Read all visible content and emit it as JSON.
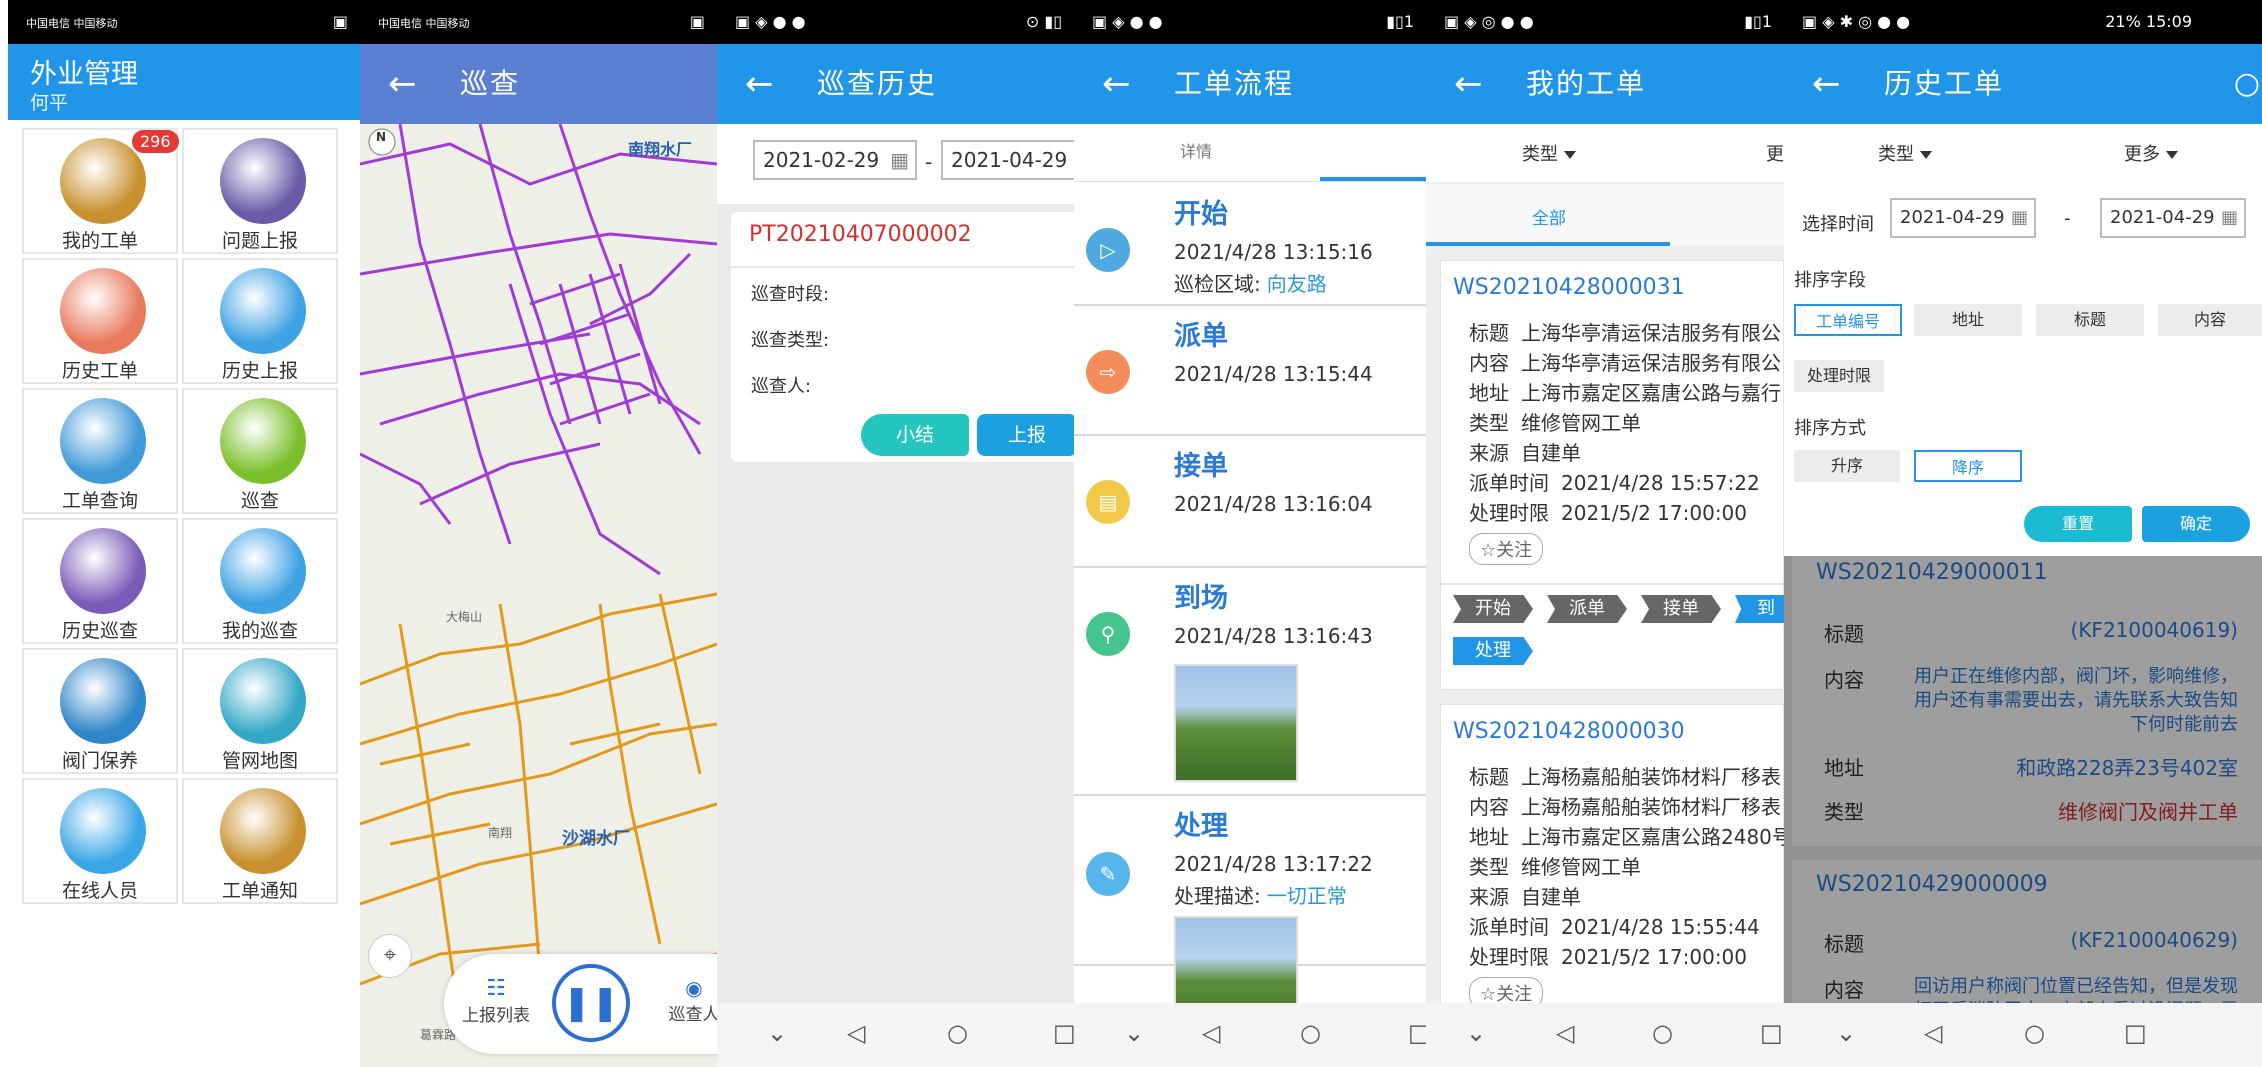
{
  "p1": {
    "status_left": "中国电信 中国移动",
    "title": "外业管理",
    "user": "何平",
    "tiles": [
      {
        "label": "我的工单",
        "badge": "296",
        "icon": "briefcase-icon",
        "color": "#c8902e"
      },
      {
        "label": "问题上报",
        "icon": "question-icon",
        "color": "#6a5aa8"
      },
      {
        "label": "历史工单",
        "icon": "search-doc-icon",
        "color": "#e87a5d"
      },
      {
        "label": "历史上报",
        "icon": "image-icon",
        "color": "#3ea2e3"
      },
      {
        "label": "工单查询",
        "icon": "magnifier-icon",
        "color": "#3f9ad8"
      },
      {
        "label": "巡查",
        "icon": "box-icon",
        "color": "#7bbf2a"
      },
      {
        "label": "历史巡查",
        "icon": "folder-icon",
        "color": "#7a5cb8"
      },
      {
        "label": "我的巡查",
        "icon": "image-icon",
        "color": "#3ea2e3"
      },
      {
        "label": "阀门保养",
        "icon": "valve-icon",
        "color": "#2f86c8"
      },
      {
        "label": "管网地图",
        "icon": "map-pin-icon",
        "color": "#35a8c8"
      },
      {
        "label": "在线人员",
        "icon": "list-icon",
        "color": "#3aa6e6"
      },
      {
        "label": "工单通知",
        "icon": "briefcase-icon",
        "color": "#c8902e"
      }
    ]
  },
  "p2": {
    "title": "巡查",
    "map_labels": [
      "南翔水厂",
      "沙湖水厂",
      "大梅山",
      "南翔",
      "葛霖路"
    ],
    "compass": "N",
    "bottom": {
      "list_label": "上报列表",
      "right_label": "巡查人"
    }
  },
  "p3": {
    "title": "巡查历史",
    "date_from": "2021-02-29",
    "date_sep": "-",
    "date_to": "2021-04-29",
    "record_id": "PT20210407000002",
    "fields": [
      "巡查时段:",
      "巡查类型:",
      "巡查人:"
    ],
    "btn_summary": "小结",
    "btn_report": "上报"
  },
  "p4": {
    "title": "工单流程",
    "tab": "详情",
    "steps": [
      {
        "title": "开始",
        "time": "2021/4/28 13:15:16",
        "extra_k": "巡检区域:",
        "extra_v": "向友路",
        "color": "#4fa8e0"
      },
      {
        "title": "派单",
        "time": "2021/4/28 13:15:44",
        "color": "#f28c5a"
      },
      {
        "title": "接单",
        "time": "2021/4/28 13:16:04",
        "color": "#f3c94a"
      },
      {
        "title": "到场",
        "time": "2021/4/28 13:16:43",
        "color": "#46c48e"
      },
      {
        "title": "处理",
        "time": "2021/4/28 13:17:22",
        "extra_k": "处理描述:",
        "extra_v": "一切正常",
        "color": "#56b5ea"
      }
    ]
  },
  "p5": {
    "title": "我的工单",
    "filter_type": "类型",
    "filter_more": "更",
    "tab_all": "全部",
    "cards": [
      {
        "no": "WS20210428000031",
        "rows": [
          [
            "标题",
            "上海华亭清运保洁服务有限公"
          ],
          [
            "内容",
            "上海华亭清运保洁服务有限公"
          ],
          [
            "地址",
            "上海市嘉定区嘉唐公路与嘉行"
          ],
          [
            "类型",
            "维修管网工单"
          ],
          [
            "来源",
            "自建单"
          ],
          [
            "派单时间",
            "2021/4/28 15:57:22"
          ],
          [
            "处理时限",
            "2021/5/2 17:00:00"
          ]
        ],
        "follow": "☆关注",
        "flow": [
          "开始",
          "派单",
          "接单",
          "到"
        ],
        "flow2": "处理"
      },
      {
        "no": "WS20210428000030",
        "rows": [
          [
            "标题",
            "上海杨嘉船舶装饰材料厂移表"
          ],
          [
            "内容",
            "上海杨嘉船舶装饰材料厂移表"
          ],
          [
            "地址",
            "上海市嘉定区嘉唐公路2480号"
          ],
          [
            "类型",
            "维修管网工单"
          ],
          [
            "来源",
            "自建单"
          ],
          [
            "派单时间",
            "2021/4/28 15:55:44"
          ],
          [
            "处理时限",
            "2021/5/2 17:00:00"
          ]
        ],
        "follow": "☆关注"
      }
    ]
  },
  "p6": {
    "status_right": "21% 15:09",
    "title": "历史工单",
    "filter_type": "类型",
    "filter_more": "更多",
    "time_label": "选择时间",
    "date_from": "2021-04-29",
    "date_sep": "-",
    "date_to": "2021-04-29",
    "sort_field_label": "排序字段",
    "sort_fields": [
      "工单编号",
      "地址",
      "标题",
      "内容",
      "处理时限"
    ],
    "sort_order_label": "排序方式",
    "sort_orders": [
      "升序",
      "降序"
    ],
    "btn_reset": "重置",
    "btn_ok": "确定",
    "cards": [
      {
        "no": "WS20210429000011",
        "title_k": "标题",
        "title_v": "(KF2100040619)",
        "content_k": "内容",
        "content_v1": "用户正在维修内部，阀门坏，影响维修，",
        "content_v2": "用户还有事需要出去，请先联系大致告知",
        "content_v3": "下何时能前去",
        "addr_k": "地址",
        "addr_v": "和政路228弄23号402室",
        "type_k": "类型",
        "type_v": "维修阀门及阀井工单"
      },
      {
        "no": "WS20210429000009",
        "title_k": "标题",
        "title_v": "(KF2100040629)",
        "content_k": "内容",
        "content_v1": "回访用户称阀门位置已经告知，但是发现",
        "content_v2": "打开后消防无水，内部查看过没问题，需"
      }
    ]
  },
  "colors": {
    "primary": "#2196e8",
    "accent": "#1bbcd2",
    "red": "#e53935"
  }
}
